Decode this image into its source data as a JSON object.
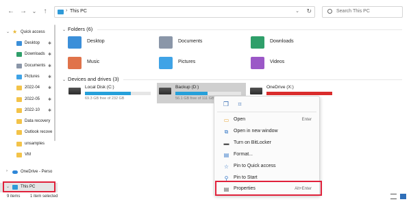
{
  "address": {
    "location": "This PC",
    "sep": "›"
  },
  "search": {
    "placeholder": "Search This PC"
  },
  "nav": {
    "back": "←",
    "forward": "→",
    "down": "⌄",
    "up": "↑",
    "dropdown": "⌄",
    "refresh": "↻"
  },
  "sidebar": {
    "quick_access": "Quick access",
    "items": [
      {
        "label": "Desktop",
        "color": "#3b8fd9",
        "pinned": true
      },
      {
        "label": "Downloads",
        "color": "#2f9f6a",
        "pinned": true
      },
      {
        "label": "Documents",
        "color": "#8a96a8",
        "pinned": true
      },
      {
        "label": "Pictures",
        "color": "#3fa3e6",
        "pinned": true
      },
      {
        "label": "2022-04",
        "color": "#f3c349",
        "pinned": true
      },
      {
        "label": "2022-05",
        "color": "#f3c349",
        "pinned": true
      },
      {
        "label": "2022-10",
        "color": "#f3c349",
        "pinned": true
      },
      {
        "label": "Data recovery",
        "color": "#f3c349",
        "pinned": false
      },
      {
        "label": "Outlook recove",
        "color": "#f3c349",
        "pinned": false
      },
      {
        "label": "unsamples",
        "color": "#f3c349",
        "pinned": false
      },
      {
        "label": "VM",
        "color": "#f3c349",
        "pinned": false
      }
    ],
    "onedrive": "OneDrive - Perso",
    "this_pc": "This PC",
    "pin_glyph": "✱",
    "chev_right": "›",
    "chev_down": "⌄"
  },
  "folders": {
    "header": "Folders (6)",
    "items": [
      {
        "name": "Desktop",
        "color": "#3b8fd9"
      },
      {
        "name": "Documents",
        "color": "#8a96a8"
      },
      {
        "name": "Downloads",
        "color": "#2f9f6a"
      },
      {
        "name": "Music",
        "color": "#e0734a"
      },
      {
        "name": "Pictures",
        "color": "#3fa3e6"
      },
      {
        "name": "Videos",
        "color": "#9b58c7"
      }
    ]
  },
  "drives": {
    "header": "Devices and drives (3)",
    "items": [
      {
        "name": "Local Disk (C:)",
        "free": "69.3 GB free of 232 GB",
        "used_fraction": 0.7,
        "fill_color": "#26a0da"
      },
      {
        "name": "Backup (D:)",
        "free": "56.1 GB free of 111 GB",
        "used_fraction": 0.49,
        "fill_color": "#26a0da"
      },
      {
        "name": "OneDrive (X:)",
        "free": "",
        "used_fraction": 1.0,
        "fill_color": "#da2c2c"
      }
    ]
  },
  "context_menu": {
    "top_icons": [
      "copy-icon",
      "rename-icon"
    ],
    "items": [
      {
        "label": "Open",
        "shortcut": "Enter",
        "icon": "▭",
        "icon_color": "#e8a73a"
      },
      {
        "label": "Open in new window",
        "shortcut": "",
        "icon": "⧉",
        "icon_color": "#3a7bc8"
      },
      {
        "label": "Turn on BitLocker",
        "shortcut": "",
        "icon": "▬",
        "icon_color": "#555555"
      },
      {
        "label": "Format...",
        "shortcut": "",
        "icon": "▤",
        "icon_color": "#3a7bc8"
      },
      {
        "label": "Pin to Quick access",
        "shortcut": "",
        "icon": "☆",
        "icon_color": "#3a7bc8"
      },
      {
        "label": "Pin to Start",
        "shortcut": "",
        "icon": "⚲",
        "icon_color": "#3a7bc8"
      },
      {
        "label": "Properties",
        "shortcut": "Alt+Enter",
        "icon": "▤",
        "icon_color": "#555555"
      }
    ]
  },
  "status": {
    "items": "9 items",
    "selected": "1 item selected"
  },
  "colors": {
    "highlight": "#e0203a",
    "selection": "#cfcfcf"
  }
}
